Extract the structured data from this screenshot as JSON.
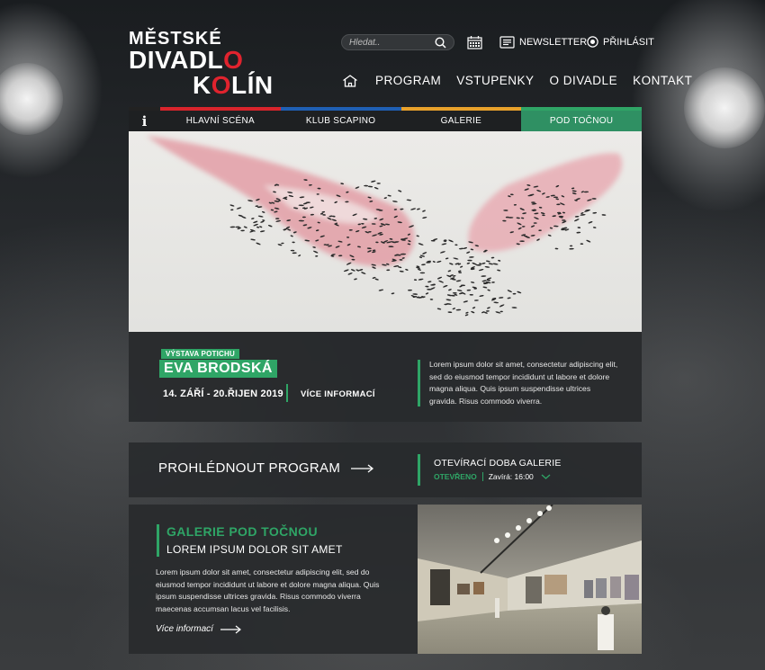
{
  "logo": {
    "line1": "MĚSTSKÉ",
    "line2a": "DIVADL",
    "line2b": "O",
    "line3a": "K",
    "line3b": "O",
    "line3c": "LÍN"
  },
  "header": {
    "search_placeholder": "Hledat..",
    "newsletter": "NEWSLETTER",
    "login": "PŘIHLÁSIT"
  },
  "nav": {
    "items": [
      "PROGRAM",
      "VSTUPENKY",
      "O DIVADLE",
      "KONTAKT"
    ]
  },
  "subnav": {
    "info": "i",
    "tabs": [
      {
        "label": "HLAVNÍ SCÉNA",
        "color": "#d9242c"
      },
      {
        "label": "KLUB SCAPINO",
        "color": "#1f5fb4"
      },
      {
        "label": "GALERIE",
        "color": "#e8a12b"
      },
      {
        "label": "POD TOČNOU",
        "color": "#2fa566"
      }
    ]
  },
  "feature": {
    "tag": "VÝSTAVA POTICHU",
    "name": "EVA BRODSKÁ",
    "date": "14. ZÁŘÍ - 20.ŘIJEN 2019",
    "more": "VÍCE INFORMACÍ",
    "desc": "Lorem ipsum dolor sit amet, consectetur adipiscing elit, sed do eiusmod tempor incididunt ut labore et dolore magna aliqua. Quis ipsum suspendisse ultrices gravida. Risus commodo viverra."
  },
  "program": {
    "link": "PROHLÉDNOUT PROGRAM",
    "hours_title": "OTEVÍRACÍ DOBA GALERIE",
    "status_open": "OTEVŘENO",
    "closes": "Zavírá: 16:00"
  },
  "gallery": {
    "title": "GALERIE POD TOČNOU",
    "subtitle": "LOREM IPSUM DOLOR SIT AMET",
    "desc": "Lorem ipsum dolor sit amet, consectetur adipiscing elit, sed do eiusmod tempor incididunt ut labore et dolore magna aliqua. Quis ipsum suspendisse ultrices gravida. Risus commodo viverra maecenas accumsan lacus vel facilisis.",
    "more": "Více informací"
  },
  "colors": {
    "accent_green": "#2fa566",
    "logo_red": "#e0232e"
  }
}
